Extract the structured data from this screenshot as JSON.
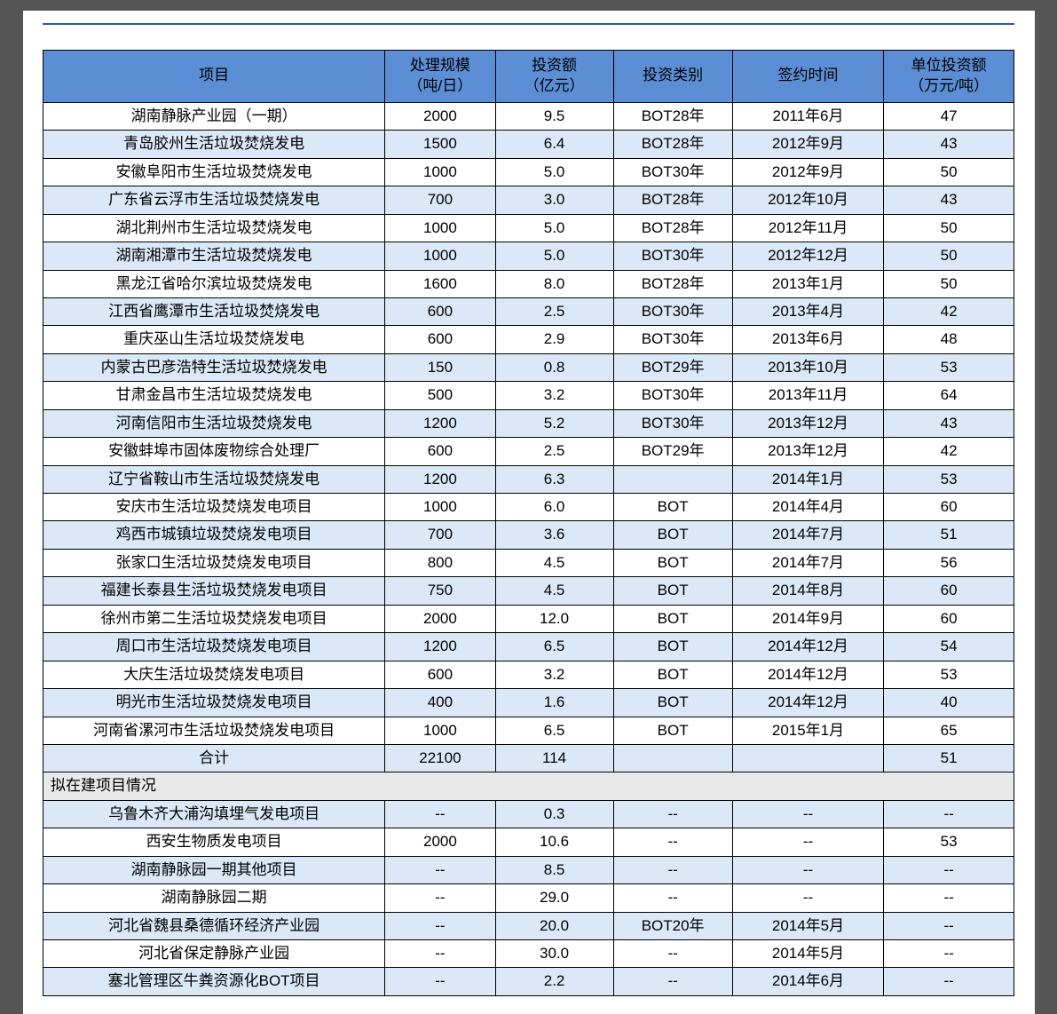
{
  "chart_data": {
    "type": "table",
    "title": "",
    "columns": [
      "项目",
      "处理规模（吨/日）",
      "投资额（亿元）",
      "投资类别",
      "签约时间",
      "单位投资额（万元/吨）"
    ],
    "sections": [
      {
        "name": "(no header)",
        "rows": [
          [
            "湖南静脉产业园（一期）",
            "2000",
            "9.5",
            "BOT28年",
            "2011年6月",
            "47"
          ],
          [
            "青岛胶州生活垃圾焚烧发电",
            "1500",
            "6.4",
            "BOT28年",
            "2012年9月",
            "43"
          ],
          [
            "安徽阜阳市生活垃圾焚烧发电",
            "1000",
            "5.0",
            "BOT30年",
            "2012年9月",
            "50"
          ],
          [
            "广东省云浮市生活垃圾焚烧发电",
            "700",
            "3.0",
            "BOT28年",
            "2012年10月",
            "43"
          ],
          [
            "湖北荆州市生活垃圾焚烧发电",
            "1000",
            "5.0",
            "BOT28年",
            "2012年11月",
            "50"
          ],
          [
            "湖南湘潭市生活垃圾焚烧发电",
            "1000",
            "5.0",
            "BOT30年",
            "2012年12月",
            "50"
          ],
          [
            "黑龙江省哈尔滨垃圾焚烧发电",
            "1600",
            "8.0",
            "BOT28年",
            "2013年1月",
            "50"
          ],
          [
            "江西省鹰潭市生活垃圾焚烧发电",
            "600",
            "2.5",
            "BOT30年",
            "2013年4月",
            "42"
          ],
          [
            "重庆巫山生活垃圾焚烧发电",
            "600",
            "2.9",
            "BOT30年",
            "2013年6月",
            "48"
          ],
          [
            "内蒙古巴彦浩特生活垃圾焚烧发电",
            "150",
            "0.8",
            "BOT29年",
            "2013年10月",
            "53"
          ],
          [
            "甘肃金昌市生活垃圾焚烧发电",
            "500",
            "3.2",
            "BOT30年",
            "2013年11月",
            "64"
          ],
          [
            "河南信阳市生活垃圾焚烧发电",
            "1200",
            "5.2",
            "BOT30年",
            "2013年12月",
            "43"
          ],
          [
            "安徽蚌埠市固体废物综合处理厂",
            "600",
            "2.5",
            "BOT29年",
            "2013年12月",
            "42"
          ],
          [
            "辽宁省鞍山市生活垃圾焚烧发电",
            "1200",
            "6.3",
            "",
            "2014年1月",
            "53"
          ],
          [
            "安庆市生活垃圾焚烧发电项目",
            "1000",
            "6.0",
            "BOT",
            "2014年4月",
            "60"
          ],
          [
            "鸡西市城镇垃圾焚烧发电项目",
            "700",
            "3.6",
            "BOT",
            "2014年7月",
            "51"
          ],
          [
            "张家口生活垃圾焚烧发电项目",
            "800",
            "4.5",
            "BOT",
            "2014年7月",
            "56"
          ],
          [
            "福建长泰县生活垃圾焚烧发电项目",
            "750",
            "4.5",
            "BOT",
            "2014年8月",
            "60"
          ],
          [
            "徐州市第二生活垃圾焚烧发电项目",
            "2000",
            "12.0",
            "BOT",
            "2014年9月",
            "60"
          ],
          [
            "周口市生活垃圾焚烧发电项目",
            "1200",
            "6.5",
            "BOT",
            "2014年12月",
            "54"
          ],
          [
            "大庆生活垃圾焚烧发电项目",
            "600",
            "3.2",
            "BOT",
            "2014年12月",
            "53"
          ],
          [
            "明光市生活垃圾焚烧发电项目",
            "400",
            "1.6",
            "BOT",
            "2014年12月",
            "40"
          ],
          [
            "河南省漯河市生活垃圾焚烧发电项目",
            "1000",
            "6.5",
            "BOT",
            "2015年1月",
            "65"
          ],
          [
            "合计",
            "22100",
            "114",
            "",
            "",
            "51"
          ]
        ]
      },
      {
        "name": "拟在建项目情况",
        "rows": [
          [
            "乌鲁木齐大浦沟填埋气发电项目",
            "--",
            "0.3",
            "--",
            "--",
            "--"
          ],
          [
            "西安生物质发电项目",
            "2000",
            "10.6",
            "--",
            "--",
            "53"
          ],
          [
            "湖南静脉园一期其他项目",
            "--",
            "8.5",
            "--",
            "--",
            "--"
          ],
          [
            "湖南静脉园二期",
            "--",
            "29.0",
            "--",
            "--",
            "--"
          ],
          [
            "河北省魏县桑德循环经济产业园",
            "--",
            "20.0",
            "BOT20年",
            "2014年5月",
            "--"
          ],
          [
            "河北省保定静脉产业园",
            "--",
            "30.0",
            "--",
            "2014年5月",
            "--"
          ],
          [
            "塞北管理区牛粪资源化BOT项目",
            "--",
            "2.2",
            "--",
            "2014年6月",
            "--"
          ]
        ]
      }
    ]
  },
  "headers": {
    "c1": "项目",
    "c2l1": "处理规模",
    "c2l2": "（吨/日）",
    "c3l1": "投资额",
    "c3l2": "（亿元）",
    "c4": "投资类别",
    "c5": "签约时间",
    "c6l1": "单位投资额",
    "c6l2": "（万元/吨）"
  },
  "section2": "拟在建项目情况",
  "r": {
    "a": [
      "湖南静脉产业园（一期）",
      "2000",
      "9.5",
      "BOT28年",
      "2011年6月",
      "47"
    ],
    "b": [
      "青岛胶州生活垃圾焚烧发电",
      "1500",
      "6.4",
      "BOT28年",
      "2012年9月",
      "43"
    ],
    "c": [
      "安徽阜阳市生活垃圾焚烧发电",
      "1000",
      "5.0",
      "BOT30年",
      "2012年9月",
      "50"
    ],
    "d": [
      "广东省云浮市生活垃圾焚烧发电",
      "700",
      "3.0",
      "BOT28年",
      "2012年10月",
      "43"
    ],
    "e": [
      "湖北荆州市生活垃圾焚烧发电",
      "1000",
      "5.0",
      "BOT28年",
      "2012年11月",
      "50"
    ],
    "f": [
      "湖南湘潭市生活垃圾焚烧发电",
      "1000",
      "5.0",
      "BOT30年",
      "2012年12月",
      "50"
    ],
    "g": [
      "黑龙江省哈尔滨垃圾焚烧发电",
      "1600",
      "8.0",
      "BOT28年",
      "2013年1月",
      "50"
    ],
    "h": [
      "江西省鹰潭市生活垃圾焚烧发电",
      "600",
      "2.5",
      "BOT30年",
      "2013年4月",
      "42"
    ],
    "i": [
      "重庆巫山生活垃圾焚烧发电",
      "600",
      "2.9",
      "BOT30年",
      "2013年6月",
      "48"
    ],
    "j": [
      "内蒙古巴彦浩特生活垃圾焚烧发电",
      "150",
      "0.8",
      "BOT29年",
      "2013年10月",
      "53"
    ],
    "k": [
      "甘肃金昌市生活垃圾焚烧发电",
      "500",
      "3.2",
      "BOT30年",
      "2013年11月",
      "64"
    ],
    "l": [
      "河南信阳市生活垃圾焚烧发电",
      "1200",
      "5.2",
      "BOT30年",
      "2013年12月",
      "43"
    ],
    "m": [
      "安徽蚌埠市固体废物综合处理厂",
      "600",
      "2.5",
      "BOT29年",
      "2013年12月",
      "42"
    ],
    "n": [
      "辽宁省鞍山市生活垃圾焚烧发电",
      "1200",
      "6.3",
      "",
      "2014年1月",
      "53"
    ],
    "o": [
      "安庆市生活垃圾焚烧发电项目",
      "1000",
      "6.0",
      "BOT",
      "2014年4月",
      "60"
    ],
    "p": [
      "鸡西市城镇垃圾焚烧发电项目",
      "700",
      "3.6",
      "BOT",
      "2014年7月",
      "51"
    ],
    "q": [
      "张家口生活垃圾焚烧发电项目",
      "800",
      "4.5",
      "BOT",
      "2014年7月",
      "56"
    ],
    "s": [
      "福建长泰县生活垃圾焚烧发电项目",
      "750",
      "4.5",
      "BOT",
      "2014年8月",
      "60"
    ],
    "t": [
      "徐州市第二生活垃圾焚烧发电项目",
      "2000",
      "12.0",
      "BOT",
      "2014年9月",
      "60"
    ],
    "u": [
      "周口市生活垃圾焚烧发电项目",
      "1200",
      "6.5",
      "BOT",
      "2014年12月",
      "54"
    ],
    "v": [
      "大庆生活垃圾焚烧发电项目",
      "600",
      "3.2",
      "BOT",
      "2014年12月",
      "53"
    ],
    "w": [
      "明光市生活垃圾焚烧发电项目",
      "400",
      "1.6",
      "BOT",
      "2014年12月",
      "40"
    ],
    "x": [
      "河南省漯河市生活垃圾焚烧发电项目",
      "1000",
      "6.5",
      "BOT",
      "2015年1月",
      "65"
    ],
    "y": [
      "合计",
      "22100",
      "114",
      "",
      "",
      "51"
    ],
    "z1": [
      "乌鲁木齐大浦沟填埋气发电项目",
      "--",
      "0.3",
      "--",
      "--",
      "--"
    ],
    "z2": [
      "西安生物质发电项目",
      "2000",
      "10.6",
      "--",
      "--",
      "53"
    ],
    "z3": [
      "湖南静脉园一期其他项目",
      "--",
      "8.5",
      "--",
      "--",
      "--"
    ],
    "z4": [
      "湖南静脉园二期",
      "--",
      "29.0",
      "--",
      "--",
      "--"
    ],
    "z5": [
      "河北省魏县桑德循环经济产业园",
      "--",
      "20.0",
      "BOT20年",
      "2014年5月",
      "--"
    ],
    "z6": [
      "河北省保定静脉产业园",
      "--",
      "30.0",
      "--",
      "2014年5月",
      "--"
    ],
    "z7": [
      "塞北管理区牛粪资源化BOT项目",
      "--",
      "2.2",
      "--",
      "2014年6月",
      "--"
    ]
  }
}
